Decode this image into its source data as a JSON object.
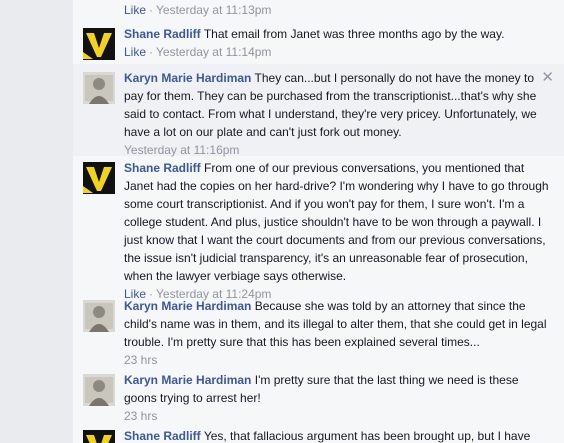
{
  "comments": [
    {
      "meta": {
        "like": "Like",
        "time": "Yesterday at 11:13pm"
      }
    },
    {
      "author": "Shane Radliff",
      "text": "That email from Janet was three months ago by the way.",
      "meta": {
        "like": "Like",
        "time": "Yesterday at 11:14pm"
      }
    },
    {
      "author": "Karyn Marie Hardiman",
      "text": "They can...but I personally do not have the money to pay for them. They can be purchased from the transcriptionist...that's why she said to contact. From what I understand, they're very pricey. Unfortunately, we have a lot on our plate and can't just fork out money.",
      "meta": {
        "time": "Yesterday at 11:16pm"
      },
      "close": "✕"
    },
    {
      "author": "Shane Radliff",
      "text": "From one of our previous conversations, you mentioned that Janet had the copies on her hard-drive? I'm wondering why I have to go through some court transcriptionist. And if you won't pay for them, I sure won't. I'm a college student. And plus, justice shouldn't have to be won through a paywall. I just know that I want the court documents and from our previous conversations, the issue isn't judicial transparency, it's an unreasonable fear of prosecution, when the lawyer verbiage says otherwise.",
      "meta": {
        "like": "Like",
        "time": "Yesterday at 11:24pm"
      }
    },
    {
      "author": "Karyn Marie Hardiman",
      "text": "Because she was told by an attorney that since the child's name was in them, and its illegal to alter them, that she could get in legal trouble. I'm pretty sure that this has been explained several times...",
      "meta": {
        "time": "23 hrs"
      }
    },
    {
      "author": "Karyn Marie Hardiman",
      "text": "I'm pretty sure that the last thing we need is these goons trying to arrest her!",
      "meta": {
        "time": "23 hrs"
      }
    },
    {
      "author": "Shane Radliff",
      "text": "Yes, that fallacious argument has been brought up, but I have"
    }
  ],
  "colors": {
    "author": "#3b5998",
    "meta": "#90949c",
    "shane_avatar": "#f2d21b"
  }
}
